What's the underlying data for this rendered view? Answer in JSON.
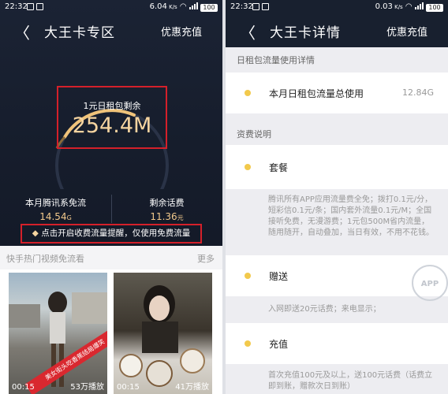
{
  "left": {
    "status": {
      "time": "22:32",
      "speed": "6.04",
      "battery": "100"
    },
    "nav": {
      "back": "〈",
      "title": "大王卡专区",
      "action": "优惠充值"
    },
    "remaining": {
      "label": "1元日租包剩余",
      "value": "254.4M"
    },
    "stats": [
      {
        "label": "本月腾讯系免流",
        "value": "14.54",
        "unit": "G"
      },
      {
        "label": "剩余话费",
        "value": "11.36",
        "unit": "元"
      }
    ],
    "tip": "点击开启收费流量提醒，仅使用免费流量",
    "section": {
      "title": "快手热门视频免流看",
      "more": "更多"
    },
    "videos": [
      {
        "duration": "00:15",
        "plays": "53万播放",
        "banner": "美女街头吃香蕉结局爆笑"
      },
      {
        "duration": "00:15",
        "plays": "41万播放"
      }
    ]
  },
  "right": {
    "status": {
      "time": "22:32",
      "speed": "0.03",
      "battery": "100"
    },
    "nav": {
      "back": "〈",
      "title": "大王卡详情",
      "action": "优惠充值"
    },
    "usage_header": "日租包流量使用详情",
    "usage": {
      "label": "本月日租包流量总使用",
      "value": "12.84G"
    },
    "fee_header": "资费说明",
    "plans": [
      {
        "title": "套餐",
        "desc": "腾讯所有APP应用流量费全免；拨打0.1元/分，短彩信0.1元/条；国内套外流量0.1元/M；全国接听免费，无漫游费；1元包500M省内流量，随用随开，自动叠加，当日有效，不用不花钱。"
      },
      {
        "title": "赠送",
        "desc": "入网即送20元话费；来电显示；"
      },
      {
        "title": "充值",
        "desc": "首次充值100元及以上，送100元话费（话费立即到账，赠款次日到账）"
      }
    ],
    "watermark": "APP"
  },
  "colors": {
    "accent_gold": "#f5d4a0",
    "highlight_red": "#d4202a",
    "dot_yellow": "#f2c94c",
    "header_dark": "#18202f"
  }
}
